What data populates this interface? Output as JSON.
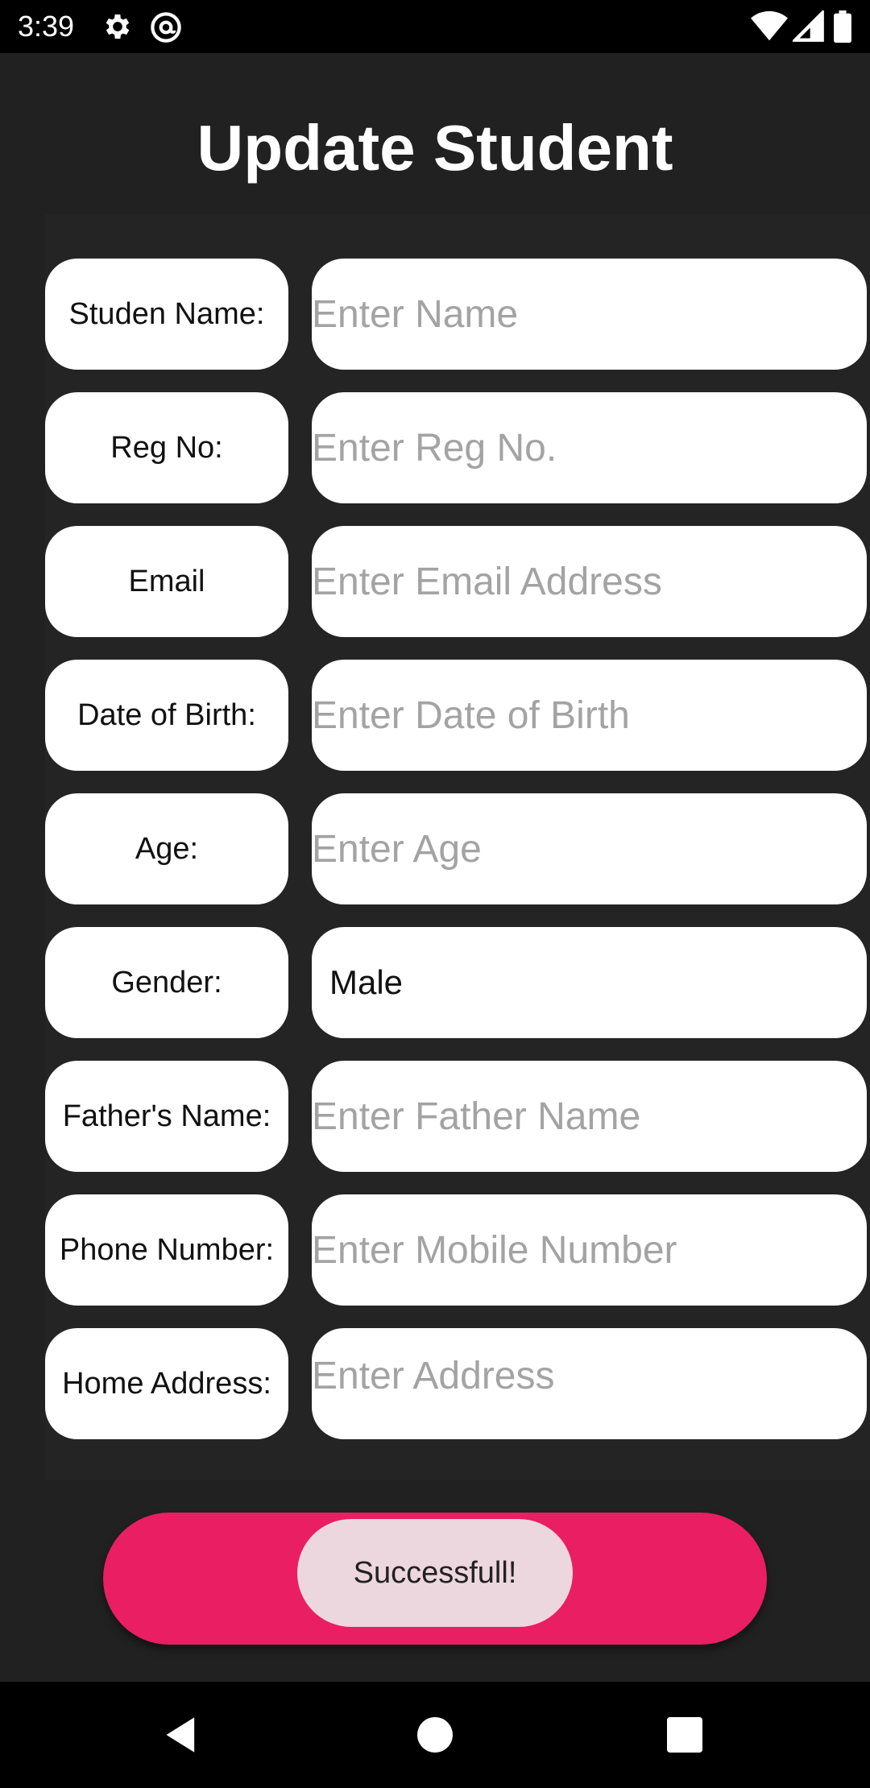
{
  "status_bar": {
    "time": "3:39"
  },
  "title": "Update Student",
  "fields": [
    {
      "label": "Studen Name:",
      "placeholder": "Enter Name"
    },
    {
      "label": "Reg No:",
      "placeholder": "Enter Reg No."
    },
    {
      "label": "Email",
      "placeholder": "Enter Email Address"
    },
    {
      "label": "Date of Birth:",
      "placeholder": "Enter Date of Birth"
    },
    {
      "label": "Age:",
      "placeholder": "Enter Age"
    },
    {
      "label": "Gender:",
      "value": "Male"
    },
    {
      "label": "Father's Name:",
      "placeholder": "Enter Father Name"
    },
    {
      "label": "Phone Number:",
      "placeholder": "Enter Mobile Number"
    },
    {
      "label": "Home Address:",
      "placeholder": "Enter Address"
    }
  ],
  "toast": "Successfull!",
  "colors": {
    "background": "#212121",
    "accent": "#e91e63",
    "toast_bg": "#ecd7df"
  },
  "icons": {
    "status": [
      "gear-icon",
      "at-sign-icon",
      "wifi-icon",
      "signal-icon",
      "battery-icon"
    ],
    "nav": [
      "back-icon",
      "home-icon",
      "recents-icon"
    ]
  }
}
